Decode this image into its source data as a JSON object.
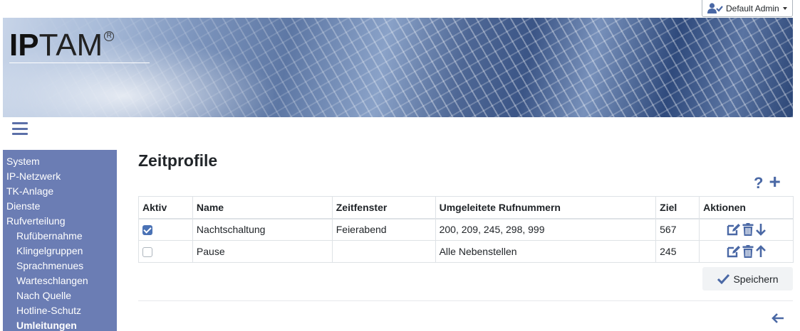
{
  "user": {
    "name": "Default Admin"
  },
  "banner": {
    "logo_bold": "IP",
    "logo_light": "TAM",
    "logo_reg": "R"
  },
  "sidebar": {
    "items": [
      {
        "label": "System",
        "level": 0,
        "active": false
      },
      {
        "label": "IP-Netzwerk",
        "level": 0,
        "active": false
      },
      {
        "label": "TK-Anlage",
        "level": 0,
        "active": false
      },
      {
        "label": "Dienste",
        "level": 0,
        "active": false
      },
      {
        "label": "Rufverteilung",
        "level": 0,
        "active": false
      },
      {
        "label": "Rufübernahme",
        "level": 1,
        "active": false
      },
      {
        "label": "Klingelgruppen",
        "level": 1,
        "active": false
      },
      {
        "label": "Sprachmenues",
        "level": 1,
        "active": false
      },
      {
        "label": "Warteschlangen",
        "level": 1,
        "active": false
      },
      {
        "label": "Nach Quelle",
        "level": 1,
        "active": false
      },
      {
        "label": "Hotline-Schutz",
        "level": 1,
        "active": false
      },
      {
        "label": "Umleitungen",
        "level": 1,
        "active": true
      }
    ]
  },
  "main": {
    "title": "Zeitprofile",
    "help_symbol": "?",
    "add_symbol": "+",
    "table": {
      "headers": [
        "Aktiv",
        "Name",
        "Zeitfenster",
        "Umgeleitete Rufnummern",
        "Ziel",
        "Aktionen"
      ],
      "rows": [
        {
          "active": true,
          "name": "Nachtschaltung",
          "zeitfenster": "Feierabend",
          "nummern": "200, 209, 245, 298, 999",
          "ziel": "567",
          "move": "down"
        },
        {
          "active": false,
          "name": "Pause",
          "zeitfenster": "",
          "nummern": "Alle Nebenstellen",
          "ziel": "245",
          "move": "up"
        }
      ]
    },
    "save_label": "Speichern"
  },
  "colors": {
    "accent": "#4a68a5",
    "sidebar": "#6b7db4",
    "checkbox": "#4a72b5"
  },
  "icons": [
    "user-check-icon",
    "caret-down-icon",
    "hamburger-icon",
    "help-icon",
    "plus-icon",
    "edit-icon",
    "trash-icon",
    "arrow-down-icon",
    "arrow-up-icon",
    "check-icon",
    "arrow-left-icon"
  ]
}
